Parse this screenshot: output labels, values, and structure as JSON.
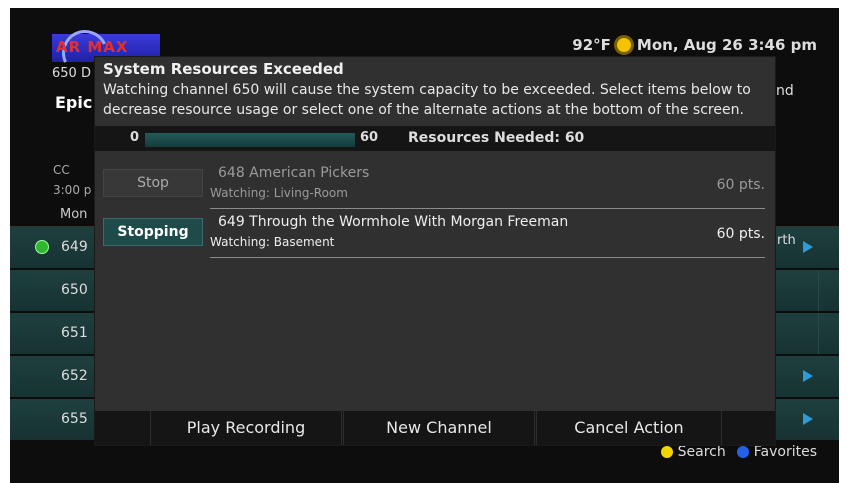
{
  "topbar": {
    "temperature": "92°F",
    "datetime": "Mon, Aug 26 3:46 pm"
  },
  "guide": {
    "logo_text": "AR MAX",
    "channel_name": "650 D",
    "show_title": "Epic",
    "right_snippet": "nd",
    "cc": "CC",
    "time": "3:00 p",
    "column_day": "Mon",
    "rows": [
      {
        "number": "649",
        "right": "rth"
      },
      {
        "number": "650",
        "right": ""
      },
      {
        "number": "651",
        "right": ""
      },
      {
        "number": "652",
        "right": ""
      },
      {
        "number": "655",
        "right": ""
      }
    ]
  },
  "modal": {
    "title": "System Resources Exceeded",
    "body": "Watching channel 650 will cause the system capacity to be exceeded. Select items below to decrease resource usage or select one of the alternate actions at the bottom of the screen.",
    "resources": {
      "min": "0",
      "max": "60",
      "needed_label": "Resources Needed: 60",
      "fill_fraction": 1.0
    },
    "items": [
      {
        "button": "Stop",
        "title": "648  American Pickers",
        "subtitle": "Watching: Living-Room",
        "points": "60 pts."
      },
      {
        "button": "Stopping",
        "title": "649  Through the Wormhole With Morgan Freeman",
        "subtitle": "Watching: Basement",
        "points": "60 pts."
      }
    ],
    "actions": [
      "Play Recording",
      "New Channel",
      "Cancel Action"
    ]
  },
  "legend": {
    "search": "Search",
    "favorites": "Favorites"
  },
  "colors": {
    "accent_teal": "#1f4a4a",
    "yellow_button": "#f2d500",
    "blue_button": "#2262e8",
    "arrow": "#2d9bd8"
  }
}
